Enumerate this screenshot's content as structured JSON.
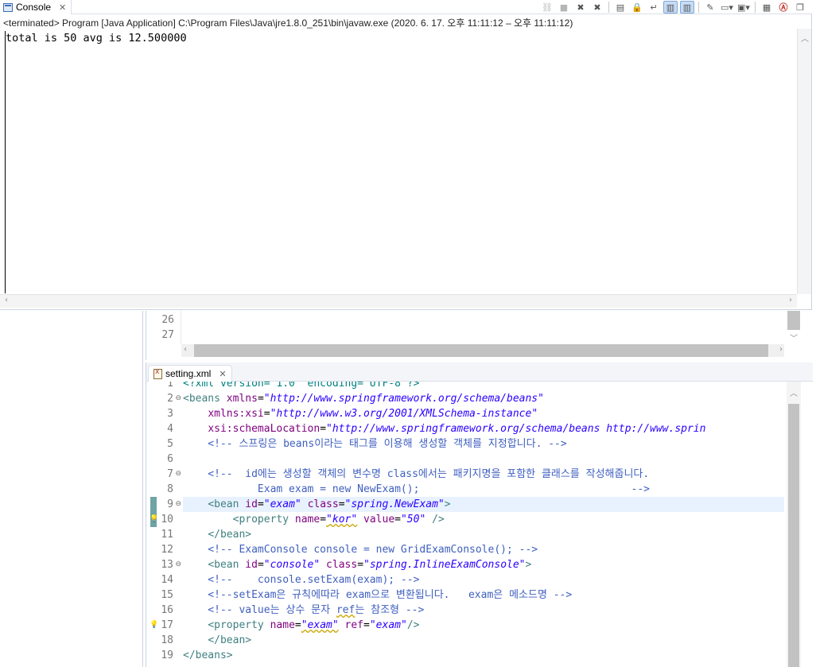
{
  "console": {
    "tab_label": "Console",
    "status": "<terminated> Program [Java Application] C:\\Program Files\\Java\\jre1.8.0_251\\bin\\javaw.exe  (2020. 6. 17. 오후 11:11:12 – 오후 11:11:12)",
    "output": "total is 50 avg is 12.500000",
    "toolbar_icons": [
      "link-icon",
      "terminate-icon",
      "remove-launch-icon",
      "remove-all-icon",
      "clear-console-icon",
      "scroll-lock-icon",
      "word-wrap-icon",
      "show-stdout-icon",
      "show-stderr-icon",
      "pin-console-icon",
      "display-console-icon",
      "open-console-icon",
      "view-menu-icon",
      "minimize-icon",
      "maximize-icon"
    ]
  },
  "java_editor": {
    "line_numbers": [
      "26",
      "27"
    ]
  },
  "xml_editor": {
    "tab_label": "setting.xml",
    "lines": [
      {
        "n": "1",
        "segments": [
          {
            "c": "t-pi",
            "t": "<?xml version=\"1.0\" encoding=\"UTF-8\"?>"
          }
        ]
      },
      {
        "n": "2",
        "fold": true,
        "segments": [
          {
            "c": "t-tag",
            "t": "<beans "
          },
          {
            "c": "t-attr",
            "t": "xmlns"
          },
          {
            "c": "t-txt",
            "t": "="
          },
          {
            "c": "t-val",
            "t": "\"http://www.springframework.org/schema/beans\""
          }
        ]
      },
      {
        "n": "3",
        "segments": [
          {
            "c": "t-txt",
            "t": "    "
          },
          {
            "c": "t-attr",
            "t": "xmlns:xsi"
          },
          {
            "c": "t-txt",
            "t": "="
          },
          {
            "c": "t-val",
            "t": "\"http://www.w3.org/2001/XMLSchema-instance\""
          }
        ]
      },
      {
        "n": "4",
        "segments": [
          {
            "c": "t-txt",
            "t": "    "
          },
          {
            "c": "t-attr",
            "t": "xsi:schemaLocation"
          },
          {
            "c": "t-txt",
            "t": "="
          },
          {
            "c": "t-val",
            "t": "\"http://www.springframework.org/schema/beans http://www.sprin"
          }
        ]
      },
      {
        "n": "5",
        "segments": [
          {
            "c": "t-cm",
            "t": "    <!-- 스프링은 beans이라는 태그를 이용해 생성할 객체를 지정합니다. -->"
          }
        ]
      },
      {
        "n": "6",
        "segments": []
      },
      {
        "n": "7",
        "fold": true,
        "segments": [
          {
            "c": "t-cm",
            "t": "    <!--  id에는 생성할 객체의 변수명 class에서는 패키지명을 포함한 클래스를 작성해줍니다."
          }
        ]
      },
      {
        "n": "8",
        "segments": [
          {
            "c": "t-cm",
            "t": "            Exam exam = new NewExam();                                  -->"
          }
        ]
      },
      {
        "n": "9",
        "fold": true,
        "current": true,
        "bar": true,
        "segments": [
          {
            "c": "t-txt",
            "t": "    "
          },
          {
            "c": "t-tag",
            "t": "<bean "
          },
          {
            "c": "t-attr",
            "t": "id"
          },
          {
            "c": "t-txt",
            "t": "="
          },
          {
            "c": "t-val",
            "t": "\"exam\""
          },
          {
            "c": "t-txt",
            "t": " "
          },
          {
            "c": "t-attr",
            "t": "class"
          },
          {
            "c": "t-txt",
            "t": "="
          },
          {
            "c": "t-val",
            "t": "\"spring.NewExam\""
          },
          {
            "c": "t-tag",
            "t": ">"
          }
        ]
      },
      {
        "n": "10",
        "bar": true,
        "bulb": true,
        "segments": [
          {
            "c": "t-txt",
            "t": "        "
          },
          {
            "c": "t-tag",
            "t": "<property "
          },
          {
            "c": "t-attr",
            "t": "name"
          },
          {
            "c": "t-txt",
            "t": "="
          },
          {
            "c": "t-val squig",
            "t": "\"kor\""
          },
          {
            "c": "t-txt",
            "t": " "
          },
          {
            "c": "t-attr",
            "t": "value"
          },
          {
            "c": "t-txt",
            "t": "="
          },
          {
            "c": "t-val",
            "t": "\"50\""
          },
          {
            "c": "t-tag",
            "t": " />"
          }
        ]
      },
      {
        "n": "11",
        "segments": [
          {
            "c": "t-txt",
            "t": "    "
          },
          {
            "c": "t-tag",
            "t": "</bean>"
          }
        ]
      },
      {
        "n": "12",
        "segments": [
          {
            "c": "t-cm",
            "t": "    <!-- ExamConsole console = new GridExamConsole(); -->"
          }
        ]
      },
      {
        "n": "13",
        "fold": true,
        "segments": [
          {
            "c": "t-txt",
            "t": "    "
          },
          {
            "c": "t-tag",
            "t": "<bean "
          },
          {
            "c": "t-attr",
            "t": "id"
          },
          {
            "c": "t-txt",
            "t": "="
          },
          {
            "c": "t-val",
            "t": "\"console\""
          },
          {
            "c": "t-txt",
            "t": " "
          },
          {
            "c": "t-attr",
            "t": "class"
          },
          {
            "c": "t-txt",
            "t": "="
          },
          {
            "c": "t-val",
            "t": "\"spring.InlineExamConsole\""
          },
          {
            "c": "t-tag",
            "t": ">"
          }
        ]
      },
      {
        "n": "14",
        "segments": [
          {
            "c": "t-cm",
            "t": "    <!--    console.setExam(exam); -->"
          }
        ]
      },
      {
        "n": "15",
        "segments": [
          {
            "c": "t-cm",
            "t": "    <!--setExam은 규칙에따라 exam으로 변환됩니다.   exam은 메소드명 -->"
          }
        ]
      },
      {
        "n": "16",
        "segments": [
          {
            "c": "t-cm",
            "t": "    <!-- value는 상수 문자 "
          },
          {
            "c": "t-cm squig",
            "t": "ref"
          },
          {
            "c": "t-cm",
            "t": "는 참조형 -->"
          }
        ]
      },
      {
        "n": "17",
        "bulb": true,
        "segments": [
          {
            "c": "t-txt",
            "t": "    "
          },
          {
            "c": "t-tag",
            "t": "<property "
          },
          {
            "c": "t-attr",
            "t": "name"
          },
          {
            "c": "t-txt",
            "t": "="
          },
          {
            "c": "t-val squig",
            "t": "\"exam\""
          },
          {
            "c": "t-txt",
            "t": " "
          },
          {
            "c": "t-attr",
            "t": "ref"
          },
          {
            "c": "t-txt",
            "t": "="
          },
          {
            "c": "t-val",
            "t": "\"exam\""
          },
          {
            "c": "t-tag",
            "t": "/>"
          }
        ]
      },
      {
        "n": "18",
        "segments": [
          {
            "c": "t-txt",
            "t": "    "
          },
          {
            "c": "t-tag",
            "t": "</bean>"
          }
        ]
      },
      {
        "n": "19",
        "segments": [
          {
            "c": "t-tag",
            "t": "</beans>"
          }
        ]
      }
    ]
  }
}
